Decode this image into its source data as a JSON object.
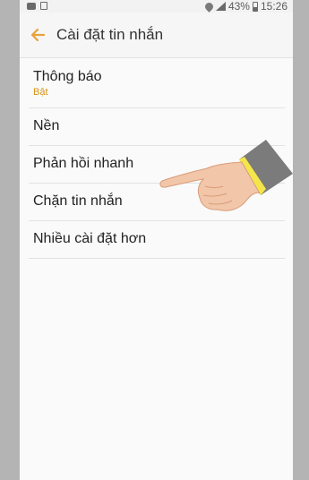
{
  "status_bar": {
    "battery_text": "43%",
    "time": "15:26",
    "battery_level": 0.43,
    "left_icons": [
      "message-icon",
      "gallery-icon"
    ],
    "right_icons": [
      "wifi-icon",
      "signal-icon",
      "battery-icon"
    ]
  },
  "app_bar": {
    "title": "Cài đặt tin nhắn",
    "back_icon": "arrow-left-icon",
    "accent_color": "#e8a23a"
  },
  "settings": {
    "items": [
      {
        "label": "Thông báo",
        "sub": "Bật"
      },
      {
        "label": "Nền"
      },
      {
        "label": "Phản hồi nhanh"
      },
      {
        "label": "Chặn tin nhắn"
      },
      {
        "label": "Nhiều cài đặt hơn"
      }
    ]
  },
  "overlay": {
    "icon": "pointing-hand-icon",
    "cuff_color": "#7b7b7b",
    "band_color": "#f4e64a"
  }
}
